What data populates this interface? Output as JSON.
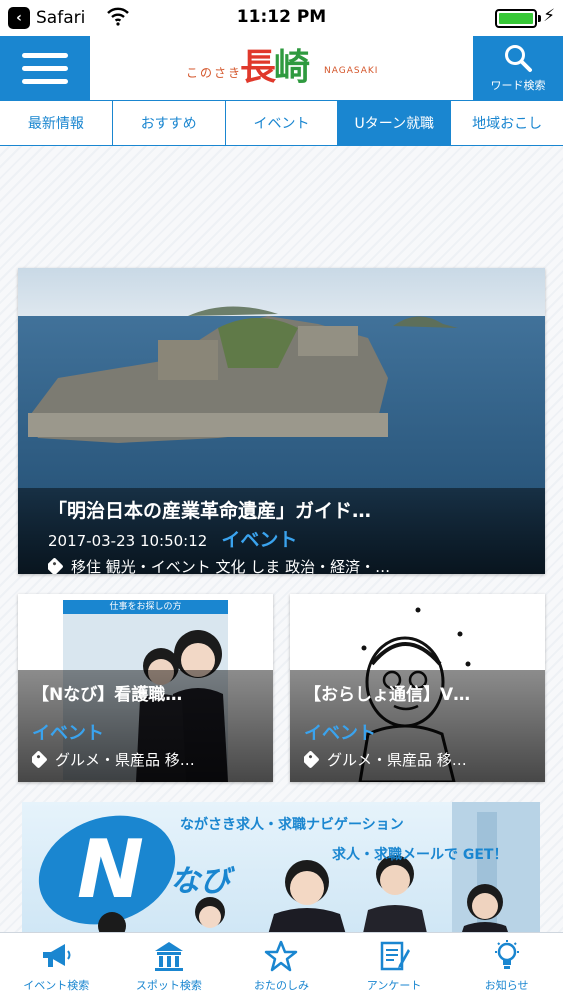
{
  "status_bar": {
    "back_app": "Safari",
    "time": "11:12 PM"
  },
  "header": {
    "logo_small": "このさき",
    "logo_big_1": "長",
    "logo_big_2": "崎",
    "logo_en": "NAGASAKI",
    "search_label": "ワード検索"
  },
  "tabs": [
    {
      "label": "最新情報",
      "active": false
    },
    {
      "label": "おすすめ",
      "active": false
    },
    {
      "label": "イベント",
      "active": false
    },
    {
      "label": "Uターン就職",
      "active": true
    },
    {
      "label": "地域おこし",
      "active": false
    }
  ],
  "hero": {
    "title": "「明治日本の産業革命遺産」ガイド…",
    "date": "2017-03-23 10:50:12",
    "category": "イベント",
    "tags": "移住 観光・イベント 文化 しま 政治・経済・…"
  },
  "cards": [
    {
      "banner_label": "仕事をお探しの方",
      "title": "【Nなび】看護職…",
      "category": "イベント",
      "tags": "グルメ・県産品 移…"
    },
    {
      "title": "【おらしょ通信】V…",
      "category": "イベント",
      "tags": "グルメ・県産品 移…"
    }
  ],
  "banner": {
    "line1": "ながさき求人・求職ナビゲーション",
    "line2": "求人・求職メールで GET！",
    "logo_text": "なび"
  },
  "bottom_bar": [
    {
      "label": "イベント検索",
      "icon": "megaphone-icon"
    },
    {
      "label": "スポット検索",
      "icon": "building-icon"
    },
    {
      "label": "おたのしみ",
      "icon": "star-icon"
    },
    {
      "label": "アンケート",
      "icon": "survey-icon"
    },
    {
      "label": "お知らせ",
      "icon": "lightbulb-icon"
    }
  ],
  "colors": {
    "accent": "#1a86d0",
    "category": "#3aa3ee",
    "battery": "#37c837"
  }
}
